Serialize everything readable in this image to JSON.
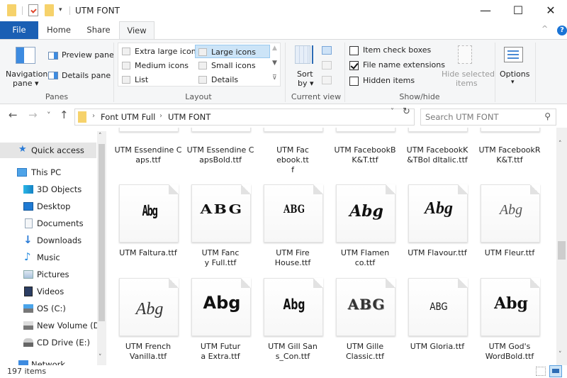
{
  "window": {
    "title": "UTM FONT",
    "minimize": "—",
    "maximize": "☐",
    "close": "✕"
  },
  "quick_access_toolbar": {
    "customize": "▾"
  },
  "tabs": [
    {
      "label": "File"
    },
    {
      "label": "Home"
    },
    {
      "label": "Share"
    },
    {
      "label": "View"
    }
  ],
  "active_tab": "View",
  "help_label": "?",
  "collapse_ribbon": "^",
  "ribbon": {
    "panes": {
      "group_label": "Panes",
      "navigation_pane": "Navigation",
      "navigation_pane_2": "pane ▾",
      "preview_pane": "Preview pane",
      "details_pane": "Details pane"
    },
    "layout": {
      "group_label": "Layout",
      "items": [
        {
          "label": "Extra large icons"
        },
        {
          "label": "Large icons",
          "selected": true
        },
        {
          "label": "Medium icons"
        },
        {
          "label": "Small icons"
        },
        {
          "label": "List"
        },
        {
          "label": "Details"
        }
      ]
    },
    "current_view": {
      "group_label": "Current view",
      "sort_by": "Sort",
      "sort_by_2": "by ▾"
    },
    "show_hide": {
      "group_label": "Show/hide",
      "item_check_boxes": {
        "label": "Item check boxes",
        "checked": false
      },
      "file_name_extensions": {
        "label": "File name extensions",
        "checked": true
      },
      "hidden_items": {
        "label": "Hidden items",
        "checked": false
      },
      "hide_selected": "Hide selected",
      "hide_selected_2": "items"
    },
    "options": {
      "label": "Options",
      "arrow": "▾"
    }
  },
  "address": {
    "back": "←",
    "forward": "→",
    "recent": "˅",
    "up": "↑",
    "breadcrumb": [
      "Font UTM Full",
      "UTM FONT"
    ],
    "separator": "›",
    "dropdown": "˅",
    "refresh": "↻",
    "search_placeholder": "Search UTM FONT",
    "search_icon": "⚲"
  },
  "sidebar": {
    "items": [
      {
        "label": "Quick access",
        "icon": "star-icon",
        "selected": true
      },
      {
        "label": "This PC",
        "icon": "computer-icon"
      },
      {
        "label": "3D Objects",
        "icon": "cube-icon"
      },
      {
        "label": "Desktop",
        "icon": "desktop-icon"
      },
      {
        "label": "Documents",
        "icon": "document-icon"
      },
      {
        "label": "Downloads",
        "icon": "download-icon"
      },
      {
        "label": "Music",
        "icon": "music-icon"
      },
      {
        "label": "Pictures",
        "icon": "pictures-icon"
      },
      {
        "label": "Videos",
        "icon": "videos-icon"
      },
      {
        "label": "OS (C:)",
        "icon": "drive-c-icon"
      },
      {
        "label": "New Volume (D:",
        "icon": "drive-icon"
      },
      {
        "label": "CD Drive (E:)",
        "icon": "cd-drive-icon"
      },
      {
        "label": "Network",
        "icon": "network-icon"
      }
    ]
  },
  "files": {
    "partial_row": [
      {
        "name": "UTM Essendine Caps.ttf"
      },
      {
        "name": "UTM Essendine CapsBold.ttf"
      },
      {
        "name": "UTM Facebook.ttf"
      },
      {
        "name": "UTM FacebookB K&T.ttf"
      },
      {
        "name": "UTM FacebookK&TBol dItalic.ttf"
      },
      {
        "name": "UTM FacebookR K&T.ttf"
      }
    ],
    "rows": [
      [
        {
          "name": "UTM Faltura.ttf",
          "preview": "Abg"
        },
        {
          "name": "UTM Fancy Full.ttf",
          "preview": "ABG"
        },
        {
          "name": "UTM Fire House.ttf",
          "preview": "ABG"
        },
        {
          "name": "UTM Flamenco.ttf",
          "preview": "Abg"
        },
        {
          "name": "UTM Flavour.ttf",
          "preview": "Abg"
        },
        {
          "name": "UTM Fleur.ttf",
          "preview": "Abg"
        }
      ],
      [
        {
          "name": "UTM French Vanilla.ttf",
          "preview": "Abg"
        },
        {
          "name": "UTM Futura Extra.ttf",
          "preview": "Abg"
        },
        {
          "name": "UTM Gill Sans_Con.ttf",
          "preview": "Abg"
        },
        {
          "name": "UTM Gille Classic.ttf",
          "preview": "ABG"
        },
        {
          "name": "UTM Gloria.ttf",
          "preview": "ABG"
        },
        {
          "name": "UTM God's WordBold.ttf",
          "preview": "Abg"
        }
      ]
    ]
  },
  "status": {
    "item_count": "197 items"
  }
}
